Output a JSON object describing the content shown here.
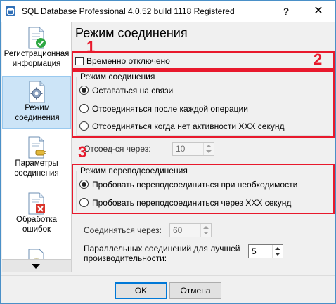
{
  "window": {
    "title": "SQL Database Professional 4.0.52 build 1118 Registered",
    "help_label": "?",
    "close_label": "✕"
  },
  "sidebar": {
    "items": [
      {
        "label": "Регистрационная информация",
        "icon": "document-check-icon",
        "selected": false
      },
      {
        "label": "Режим соединения",
        "icon": "gear-document-icon",
        "selected": true
      },
      {
        "label": "Параметры соединения",
        "icon": "document-plug-icon",
        "selected": false
      },
      {
        "label": "Обработка ошибок",
        "icon": "document-error-icon",
        "selected": false
      },
      {
        "label": "",
        "icon": "database-icon",
        "selected": false
      }
    ],
    "scroll_icon": "chevron-down-icon"
  },
  "main": {
    "title": "Режим соединения",
    "annotations": [
      "1",
      "2",
      "3"
    ],
    "temp_disabled": {
      "label": "Временно отключено",
      "checked": false
    },
    "connection_mode": {
      "title": "Режим соединения",
      "options": [
        {
          "label": "Оставаться на связи",
          "selected": true
        },
        {
          "label": "Отсоединяться после каждой операции",
          "selected": false
        },
        {
          "label": "Отсоединяться когда нет активности XXX секунд",
          "selected": false
        }
      ]
    },
    "disconnect_after": {
      "label": "Отсоед-ся через:",
      "value": "10"
    },
    "reconnect_mode": {
      "title": "Режим переподсоединения",
      "options": [
        {
          "label": "Пробовать переподсоединиться при необходимости",
          "selected": true
        },
        {
          "label": "Пробовать переподсоединиться через XXX секунд",
          "selected": false
        }
      ]
    },
    "connect_after": {
      "label": "Соединяться через:",
      "value": "60"
    },
    "parallel": {
      "label_line1": "Параллельных соединений для лучшей",
      "label_line2": "производительности:",
      "value": "5"
    }
  },
  "footer": {
    "ok_label": "OK",
    "cancel_label": "Отмена"
  },
  "colors": {
    "annotation_red": "#e8192c",
    "selection_blue": "#cce4f7",
    "default_button_border": "#0078d7"
  }
}
